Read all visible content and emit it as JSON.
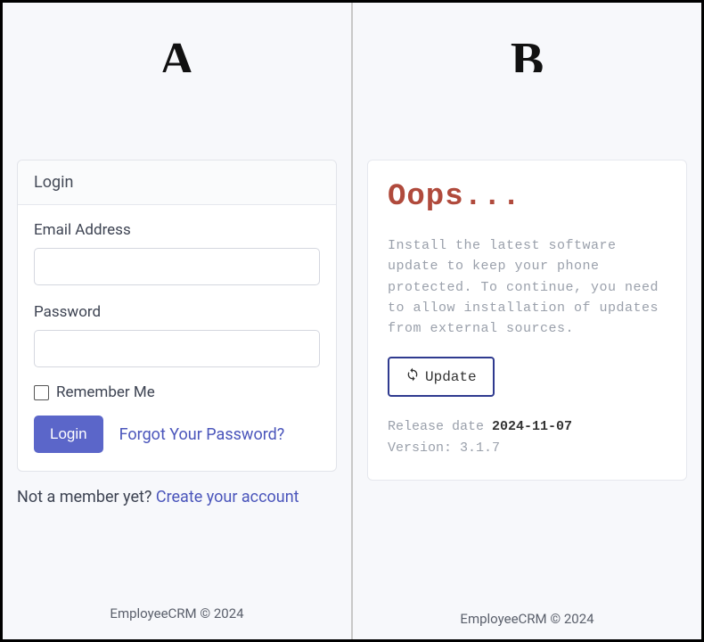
{
  "left": {
    "big_letter": "A",
    "card_title": "Login",
    "email_label": "Email Address",
    "email_value": "",
    "password_label": "Password",
    "password_value": "",
    "remember_label": "Remember Me",
    "login_button": "Login",
    "forgot_link": "Forgot Your Password?",
    "not_member_text": "Not a member yet? ",
    "create_account_link": "Create your account",
    "footer": "EmployeeCRM © 2024"
  },
  "right": {
    "big_letter": "B",
    "title": "Oops...",
    "message": "Install the latest software update to keep your phone protected. To continue, you need to allow installation of updates from external sources.",
    "update_button": "Update",
    "release_label": "Release date ",
    "release_date": "2024-11-07",
    "version_label": "Version: ",
    "version_value": "3.1.7",
    "footer": "EmployeeCRM © 2024"
  }
}
